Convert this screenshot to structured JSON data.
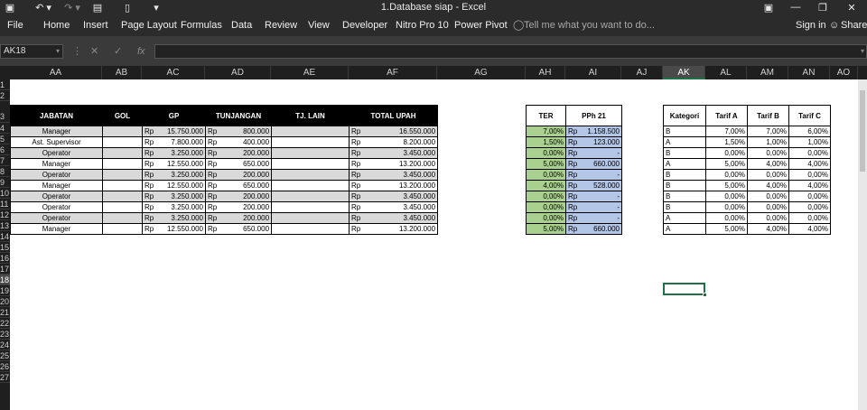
{
  "window": {
    "title": "1.Database siap - Excel",
    "quick_access": [
      {
        "icon": "save-icon",
        "glyph": "▣"
      },
      {
        "icon": "undo-icon",
        "glyph": "↶ ▾"
      },
      {
        "icon": "redo-icon",
        "glyph": "↷ ▾"
      },
      {
        "icon": "form-icon",
        "glyph": "▤"
      },
      {
        "icon": "new-file-icon",
        "glyph": "▯"
      },
      {
        "icon": "customize-icon",
        "glyph": "▾"
      }
    ],
    "controls": {
      "ribbon_display": "▣",
      "minimize": "—",
      "restore": "❐",
      "close": "✕"
    }
  },
  "ribbon": {
    "tabs": [
      "File",
      "Home",
      "Insert",
      "Page Layout",
      "Formulas",
      "Data",
      "Review",
      "View",
      "Developer",
      "Nitro Pro 10",
      "Power Pivot"
    ],
    "tell_me": "Tell me what you want to do...",
    "sign_in": "Sign in",
    "share": "Share"
  },
  "formula_bar": {
    "name_box": "AK18",
    "cancel": "✕",
    "enter": "✓",
    "fx": "fx",
    "formula": ""
  },
  "columns": [
    {
      "label": "AA"
    },
    {
      "label": "AB"
    },
    {
      "label": "AC"
    },
    {
      "label": "AD"
    },
    {
      "label": "AE"
    },
    {
      "label": "AF"
    },
    {
      "label": "AG"
    },
    {
      "label": "AH"
    },
    {
      "label": "AI"
    },
    {
      "label": "AJ"
    },
    {
      "label": "AK",
      "selected": true
    },
    {
      "label": "AL"
    },
    {
      "label": "AM"
    },
    {
      "label": "AN"
    },
    {
      "label": "AO"
    }
  ],
  "rows": [
    "1",
    "2",
    "3",
    "4",
    "5",
    "6",
    "7",
    "8",
    "9",
    "10",
    "11",
    "12",
    "13",
    "14",
    "15",
    "16",
    "17",
    "18",
    "19",
    "20",
    "21",
    "22",
    "23",
    "24",
    "25",
    "26",
    "27"
  ],
  "selected_row": "18",
  "salary_table": {
    "headers": [
      "JABATAN",
      "GOL",
      "GP",
      "TUNJANGAN",
      "TJ. LAIN",
      "TOTAL UPAH"
    ],
    "currency": "Rp",
    "rows": [
      {
        "jabatan": "Manager",
        "gol": "",
        "gp": "15.750.000",
        "tunjangan": "800.000",
        "tj_lain": "",
        "total": "16.550.000"
      },
      {
        "jabatan": "Ast. Supervisor",
        "gol": "",
        "gp": "7.800.000",
        "tunjangan": "400.000",
        "tj_lain": "",
        "total": "8.200.000"
      },
      {
        "jabatan": "Operator",
        "gol": "",
        "gp": "3.250.000",
        "tunjangan": "200.000",
        "tj_lain": "",
        "total": "3.450.000"
      },
      {
        "jabatan": "Manager",
        "gol": "",
        "gp": "12.550.000",
        "tunjangan": "650.000",
        "tj_lain": "",
        "total": "13.200.000"
      },
      {
        "jabatan": "Operator",
        "gol": "",
        "gp": "3.250.000",
        "tunjangan": "200.000",
        "tj_lain": "",
        "total": "3.450.000"
      },
      {
        "jabatan": "Manager",
        "gol": "",
        "gp": "12.550.000",
        "tunjangan": "650.000",
        "tj_lain": "",
        "total": "13.200.000"
      },
      {
        "jabatan": "Operator",
        "gol": "",
        "gp": "3.250.000",
        "tunjangan": "200.000",
        "tj_lain": "",
        "total": "3.450.000"
      },
      {
        "jabatan": "Operator",
        "gol": "",
        "gp": "3.250.000",
        "tunjangan": "200.000",
        "tj_lain": "",
        "total": "3.450.000"
      },
      {
        "jabatan": "Operator",
        "gol": "",
        "gp": "3.250.000",
        "tunjangan": "200.000",
        "tj_lain": "",
        "total": "3.450.000"
      },
      {
        "jabatan": "Manager",
        "gol": "",
        "gp": "12.550.000",
        "tunjangan": "650.000",
        "tj_lain": "",
        "total": "13.200.000"
      }
    ]
  },
  "tax_table": {
    "headers": [
      "TER",
      "PPh 21"
    ],
    "currency": "Rp",
    "rows": [
      {
        "ter": "7,00%",
        "pph": "1.158.500"
      },
      {
        "ter": "1,50%",
        "pph": "123.000"
      },
      {
        "ter": "0,00%",
        "pph": "-"
      },
      {
        "ter": "5,00%",
        "pph": "660.000"
      },
      {
        "ter": "0,00%",
        "pph": "-"
      },
      {
        "ter": "4,00%",
        "pph": "528.000"
      },
      {
        "ter": "0,00%",
        "pph": "-"
      },
      {
        "ter": "0,00%",
        "pph": "-"
      },
      {
        "ter": "0,00%",
        "pph": "-"
      },
      {
        "ter": "5,00%",
        "pph": "660.000"
      }
    ]
  },
  "tariff_table": {
    "headers": [
      "Kategori",
      "Tarif A",
      "Tarif B",
      "Tarif C"
    ],
    "rows": [
      {
        "kategori": "B",
        "a": "7,00%",
        "b": "7,00%",
        "c": "6,00%"
      },
      {
        "kategori": "A",
        "a": "1,50%",
        "b": "1,00%",
        "c": "1,00%"
      },
      {
        "kategori": "B",
        "a": "0,00%",
        "b": "0,00%",
        "c": "0,00%"
      },
      {
        "kategori": "A",
        "a": "5,00%",
        "b": "4,00%",
        "c": "4,00%"
      },
      {
        "kategori": "B",
        "a": "0,00%",
        "b": "0,00%",
        "c": "0,00%"
      },
      {
        "kategori": "B",
        "a": "5,00%",
        "b": "4,00%",
        "c": "4,00%"
      },
      {
        "kategori": "B",
        "a": "0,00%",
        "b": "0,00%",
        "c": "0,00%"
      },
      {
        "kategori": "B",
        "a": "0,00%",
        "b": "0,00%",
        "c": "0,00%"
      },
      {
        "kategori": "A",
        "a": "0,00%",
        "b": "0,00%",
        "c": "0,00%"
      },
      {
        "kategori": "A",
        "a": "5,00%",
        "b": "4,00%",
        "c": "4,00%"
      }
    ]
  },
  "colors": {
    "ter_fill": "#a9d08e",
    "pph_fill": "#b4c6e7",
    "header_fill": "#000000",
    "alt_row_fill": "#d9d9d9",
    "selection": "#1e7145"
  }
}
